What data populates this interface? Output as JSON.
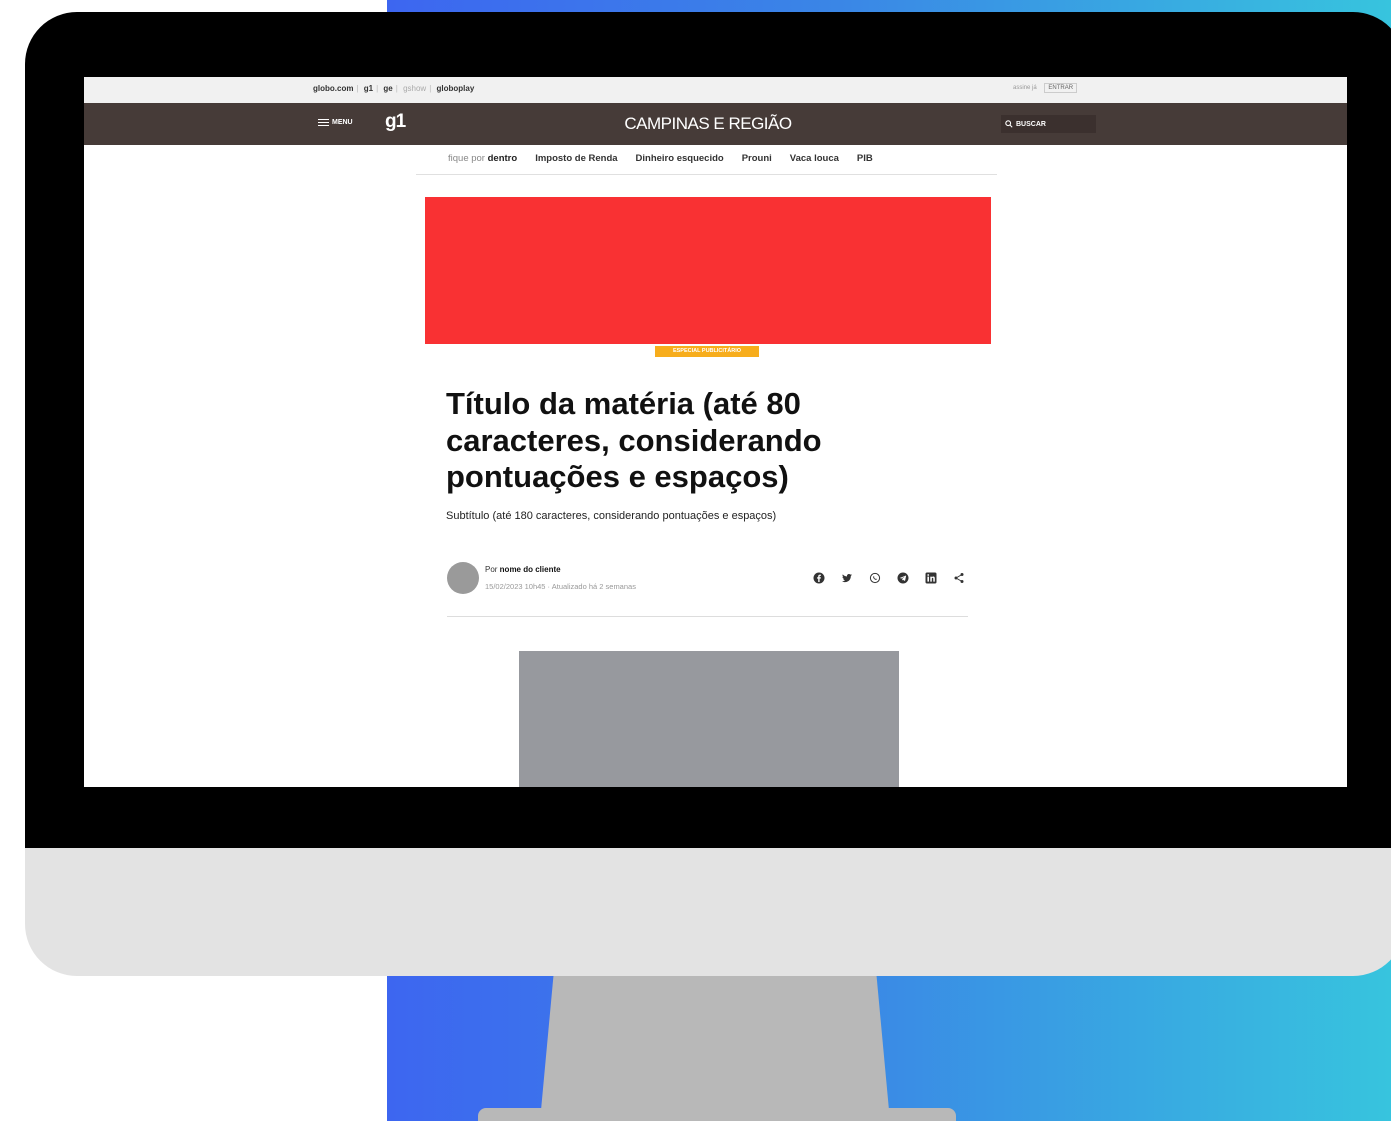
{
  "topbar": {
    "links": [
      "globo.com",
      "g1",
      "ge",
      "gshow",
      "globoplay"
    ],
    "right": [
      "assine já",
      "ENTRAR"
    ]
  },
  "navbar": {
    "menu_label": "MENU",
    "logo": "g1",
    "section_title": "CAMPINAS E REGIÃO",
    "search_label": "BUSCAR"
  },
  "subnav": {
    "fique_prefix": "fique por ",
    "fique_bold": "dentro",
    "items": [
      "Imposto de Renda",
      "Dinheiro esquecido",
      "Prouni",
      "Vaca louca",
      "PIB"
    ]
  },
  "ad": {
    "color": "#f93133"
  },
  "badge": {
    "label": "ESPECIAL PUBLICITÁRIO",
    "color": "#f7ad1c"
  },
  "article": {
    "title": "Título da matéria (até 80 caracteres, considerando pontuações e espaços)",
    "subtitle": "Subtítulo (até 180 caracteres, considerando pontuações e espaços)",
    "byline_prefix": "Por ",
    "author": "nome do cliente",
    "dateline": "15/02/2023 10h45 · Atualizado há 2 semanas"
  },
  "share_icons": [
    "facebook-icon",
    "twitter-icon",
    "whatsapp-icon",
    "telegram-icon",
    "linkedin-icon",
    "share-icon"
  ],
  "colors": {
    "navbar": "#463b38",
    "background_gradient": [
      "#3d66f0",
      "#37c4de"
    ],
    "image_placeholder": "#97999e"
  }
}
